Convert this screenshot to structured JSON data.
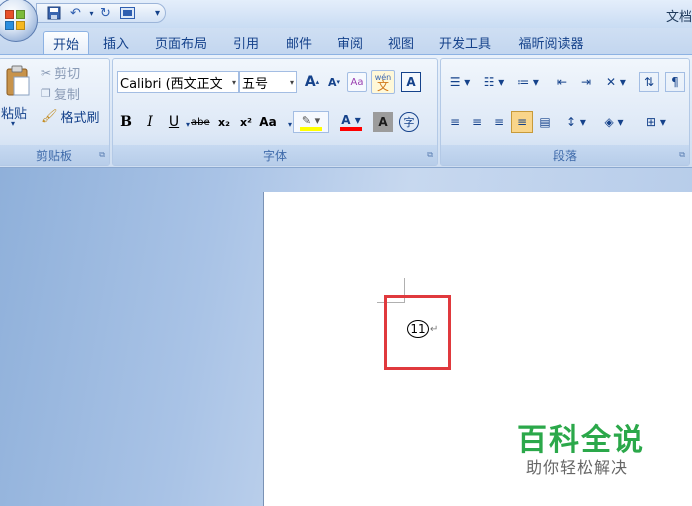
{
  "title_bar": {
    "app_title": "文档",
    "qat": {
      "save_icon": "save-icon",
      "undo_icon": "undo-icon",
      "redo_icon": "redo-icon",
      "print_preview_icon": "print-preview-icon",
      "customize_icon": "chevron-down-icon"
    }
  },
  "tabs": [
    "开始",
    "插入",
    "页面布局",
    "引用",
    "邮件",
    "审阅",
    "视图",
    "开发工具",
    "福昕阅读器"
  ],
  "active_tab": "开始",
  "clipboard": {
    "label": "剪贴板",
    "paste": "粘贴",
    "cut": "剪切",
    "copy": "复制",
    "format_painter": "格式刷"
  },
  "font": {
    "label": "字体",
    "font_name": "Calibri (西文正文",
    "font_size": "五号",
    "grow": "A",
    "shrink": "A",
    "clear": "Aa",
    "phonetic": "wén",
    "border_char": "A",
    "bold": "B",
    "italic": "I",
    "underline": "U",
    "strike": "abe",
    "subscript": "x₂",
    "superscript": "x²",
    "change_case": "Aa",
    "highlight_color": "#ffff00",
    "font_color": "#ff0000",
    "char_shading": "A",
    "enclose_char": "字"
  },
  "paragraph": {
    "label": "段落"
  },
  "document": {
    "circled_text": "11",
    "para_mark": "↵"
  },
  "watermark": {
    "main": "百科全说",
    "sub": "助你轻松解决"
  },
  "colors": {
    "accent": "#15428b",
    "highlight_box": "#e0393d",
    "watermark_green": "#2ba84a"
  }
}
